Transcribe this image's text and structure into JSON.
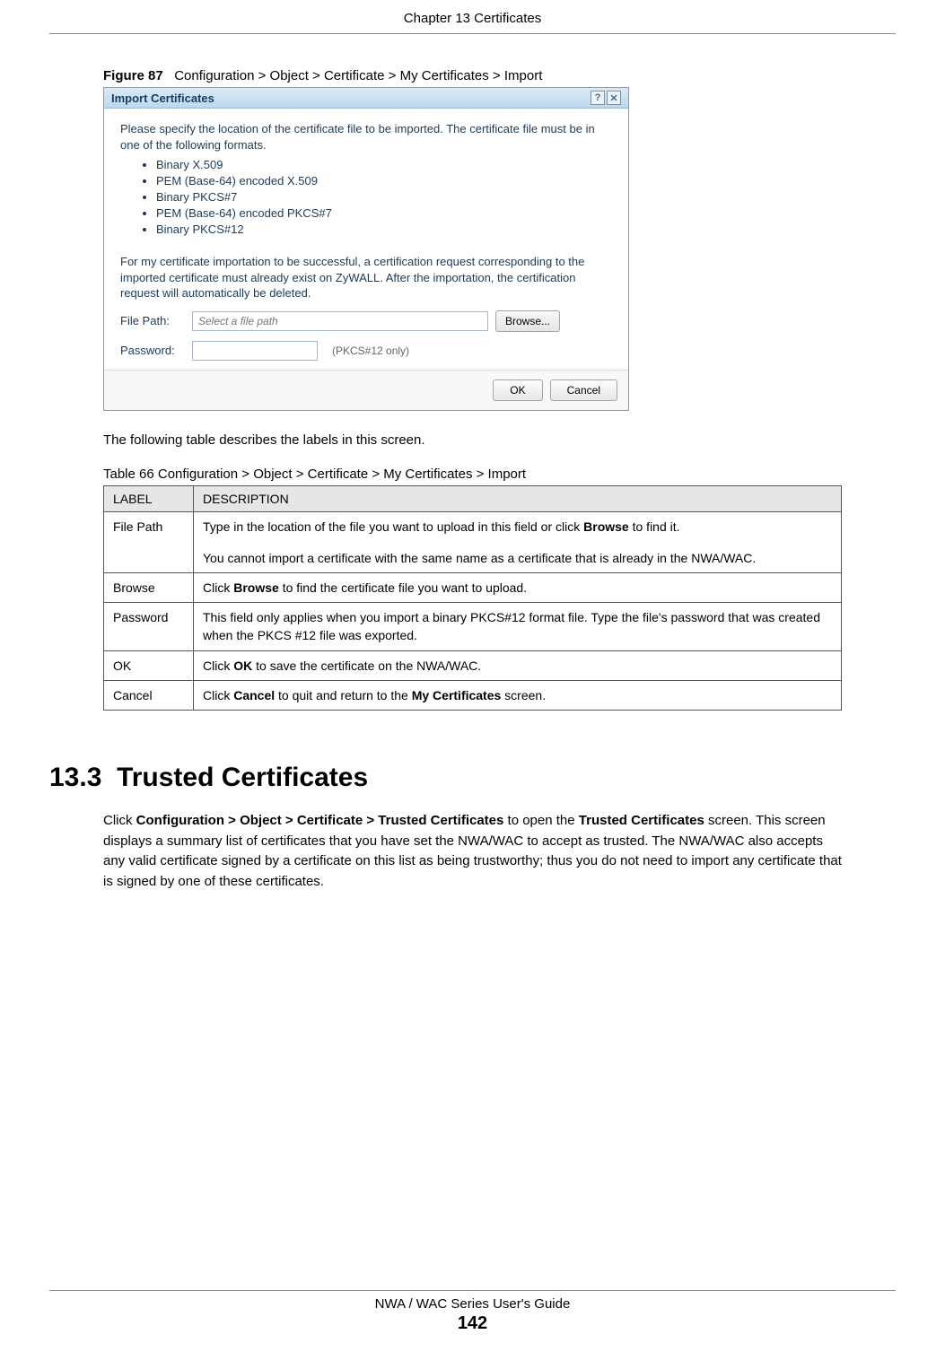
{
  "chapter_header": "Chapter 13 Certificates",
  "figure": {
    "label": "Figure 87",
    "caption": "Configuration > Object > Certificate > My Certificates > Import"
  },
  "dialog": {
    "title": "Import Certificates",
    "intro": "Please specify the location of the certificate file to be imported. The certificate file must be in one of the following formats.",
    "formats": [
      "Binary X.509",
      "PEM (Base-64) encoded X.509",
      "Binary PKCS#7",
      "PEM (Base-64) encoded PKCS#7",
      "Binary PKCS#12"
    ],
    "note": "For my certificate importation to be successful, a certification request corresponding to the imported certificate must already exist on ZyWALL. After the importation, the certification request will automatically be deleted.",
    "file_label": "File Path:",
    "file_placeholder": "Select a file path",
    "browse_label": "Browse...",
    "password_label": "Password:",
    "password_hint": "(PKCS#12 only)",
    "ok_label": "OK",
    "cancel_label": "Cancel"
  },
  "after_figure": "The following table describes the labels in this screen.",
  "table_caption": "Table 66   Configuration > Object > Certificate > My Certificates > Import",
  "table_headers": {
    "label": "LABEL",
    "description": "DESCRIPTION"
  },
  "table_rows": [
    {
      "label": "File Path",
      "desc_a": "Type in the location of the file you want to upload in this field or click ",
      "desc_bold_a": "Browse",
      "desc_b": " to find it.",
      "desc_c": "You cannot import a certificate with the same name as a certificate that is already in the NWA/WAC."
    },
    {
      "label": "Browse",
      "desc_a": "Click ",
      "desc_bold_a": "Browse",
      "desc_b": " to find the certificate file you want to upload."
    },
    {
      "label": "Password",
      "desc_a": "This field only applies when you import a binary PKCS#12 format file. Type the file's password that was created when the PKCS #12 file was exported."
    },
    {
      "label": "OK",
      "desc_a": "Click ",
      "desc_bold_a": "OK",
      "desc_b": " to save the certificate on the NWA/WAC."
    },
    {
      "label": "Cancel",
      "desc_a": "Click ",
      "desc_bold_a": "Cancel",
      "desc_b": " to quit and return to the ",
      "desc_bold_b": "My Certificates",
      "desc_c": " screen."
    }
  ],
  "section": {
    "number": "13.3",
    "title": "Trusted Certificates",
    "body_a": "Click ",
    "body_bold_a": "Configuration > Object > Certificate > Trusted Certificates",
    "body_b": " to open the ",
    "body_bold_b": "Trusted Certificates",
    "body_c": " screen. This screen displays a summary list of certificates that you have set the NWA/WAC to accept as trusted. The NWA/WAC also accepts any valid certificate signed by a certificate on this list as being trustworthy; thus you do not need to import any certificate that is signed by one of these certificates."
  },
  "footer_line": "NWA / WAC Series User's Guide",
  "footer_page": "142"
}
